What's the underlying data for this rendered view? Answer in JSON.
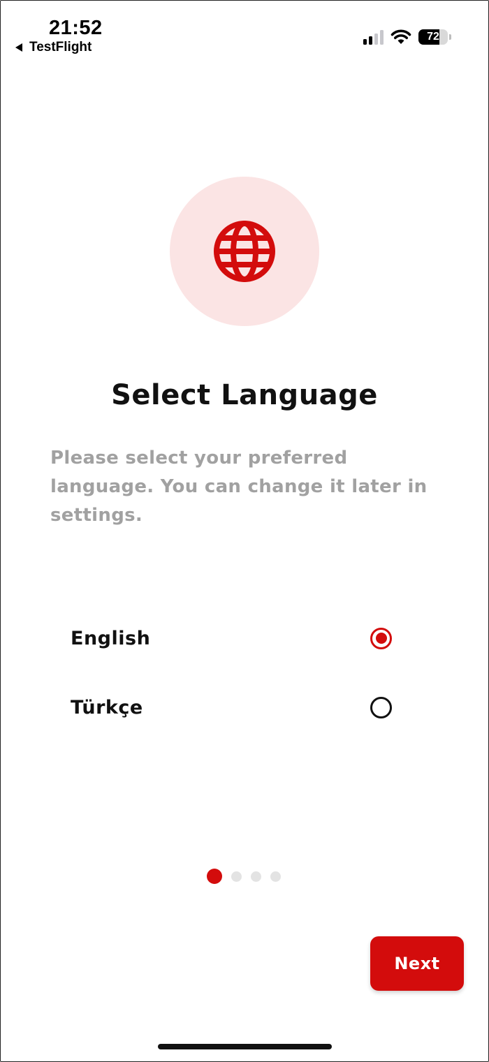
{
  "status_bar": {
    "time": "21:52",
    "back_app": "TestFlight",
    "battery_level": "72",
    "icons": [
      "signal-icon",
      "wifi-icon",
      "battery-icon"
    ]
  },
  "hero": {
    "icon": "globe-icon"
  },
  "title": "Select Language",
  "subtitle": "Please select your preferred language. You can change it later in settings.",
  "languages": [
    {
      "label": "English",
      "selected": true
    },
    {
      "label": "Türkçe",
      "selected": false
    }
  ],
  "pagination": {
    "current": 1,
    "total": 4
  },
  "next_button": "Next",
  "colors": {
    "accent": "#d30c0c",
    "accent_light": "#fbe4e4",
    "subtitle_text": "#a1a1a1"
  }
}
